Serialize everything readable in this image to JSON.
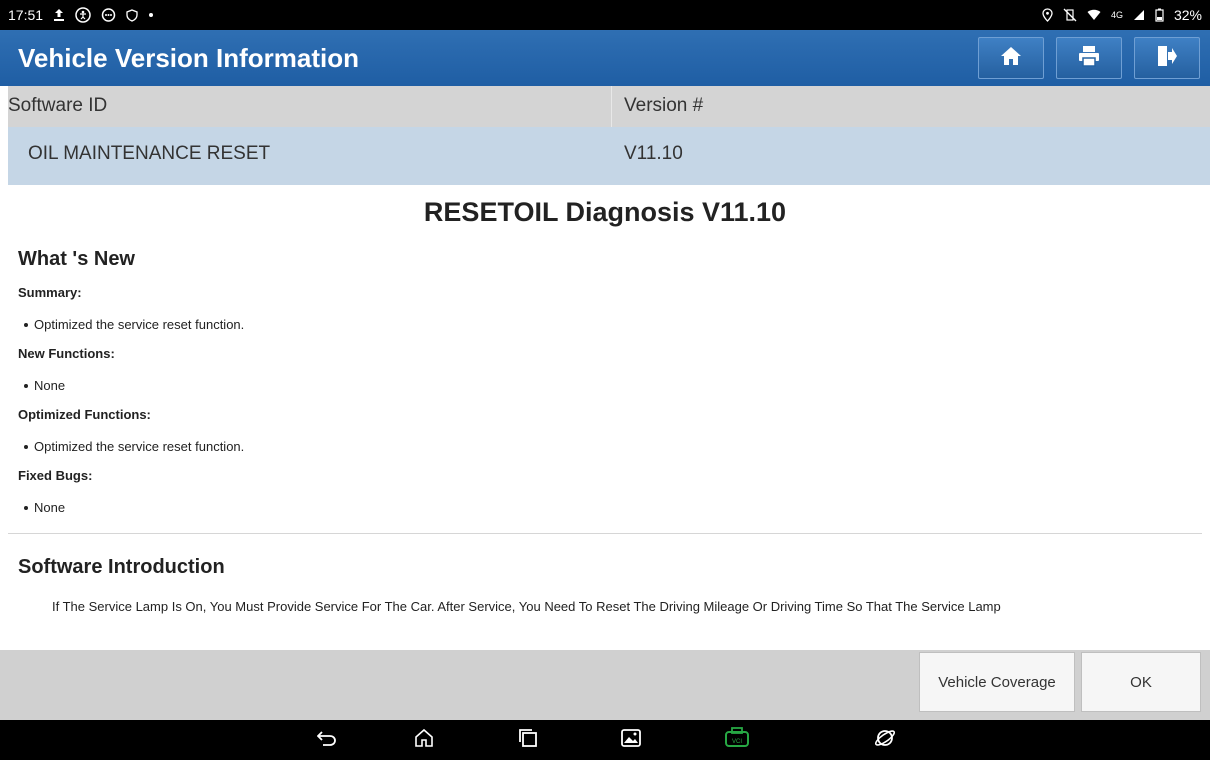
{
  "status_bar": {
    "time": "17:51",
    "network": "4G",
    "battery": "32%"
  },
  "header": {
    "title": "Vehicle Version Information"
  },
  "version_table": {
    "columns": [
      "Software ID",
      "Version #"
    ],
    "rows": [
      {
        "software_id": "OIL MAINTENANCE RESET",
        "version": "V11.10"
      }
    ]
  },
  "document": {
    "title": "RESETOIL Diagnosis V11.10",
    "whats_new_heading": "What 's New",
    "sections": [
      {
        "label": "Summary:",
        "items": [
          "Optimized the service reset function."
        ]
      },
      {
        "label": "New Functions:",
        "items": [
          "None"
        ]
      },
      {
        "label": "Optimized Functions:",
        "items": [
          "Optimized the service reset function."
        ]
      },
      {
        "label": "Fixed Bugs:",
        "items": [
          "None"
        ]
      }
    ],
    "intro_heading": "Software Introduction",
    "intro_text": "If The Service Lamp Is On, You Must Provide Service For The Car. After Service, You Need To Reset The Driving Mileage Or Driving Time So That The Service Lamp"
  },
  "footer": {
    "coverage_label": "Vehicle Coverage",
    "ok_label": "OK"
  },
  "icons": {
    "header": [
      "home-icon",
      "print-icon",
      "exit-icon"
    ],
    "nav": [
      "back-icon",
      "home-icon",
      "recents-icon",
      "gallery-icon",
      "vci-icon",
      "browser-icon"
    ]
  },
  "colors": {
    "header_bg": "#2366ab",
    "table_header_bg": "#d4d4d4",
    "table_row_bg": "#c5d6e6",
    "vci_green": "#27a844"
  }
}
